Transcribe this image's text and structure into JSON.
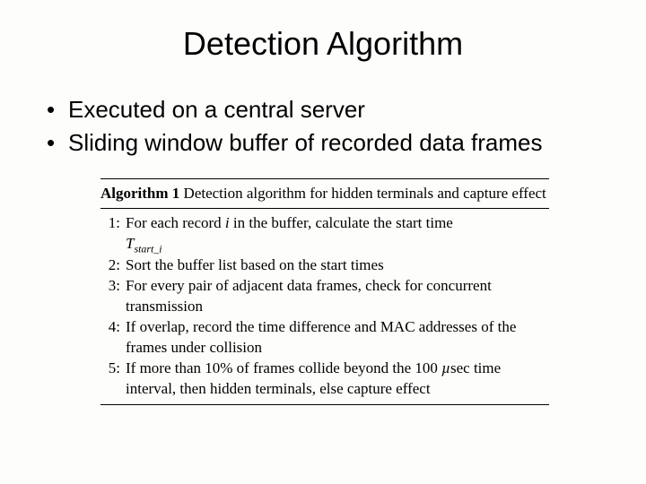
{
  "title": "Detection Algorithm",
  "bullets": [
    "Executed on a central server",
    "Sliding window buffer of recorded data frames"
  ],
  "algorithm": {
    "label": "Algorithm 1",
    "caption": "Detection algorithm for hidden terminals and capture effect",
    "steps": [
      {
        "n": "1:",
        "prefix": "For each record ",
        "var": "i",
        "suffix": " in the buffer, calculate the start time ",
        "tail_sym": "T",
        "tail_sub": "start_i"
      },
      {
        "n": "2:",
        "text": "Sort the buffer list based on the start times"
      },
      {
        "n": "3:",
        "text": "For every pair of adjacent data frames, check for concurrent transmission"
      },
      {
        "n": "4:",
        "text": "If overlap, record the time difference and MAC addresses of the frames under collision"
      },
      {
        "n": "5:",
        "prefix": "If more than 10% of frames collide beyond the 100 ",
        "unit": "µ",
        "unit_suffix": "sec",
        "suffix2": " time interval, then hidden terminals, else capture effect"
      }
    ]
  }
}
